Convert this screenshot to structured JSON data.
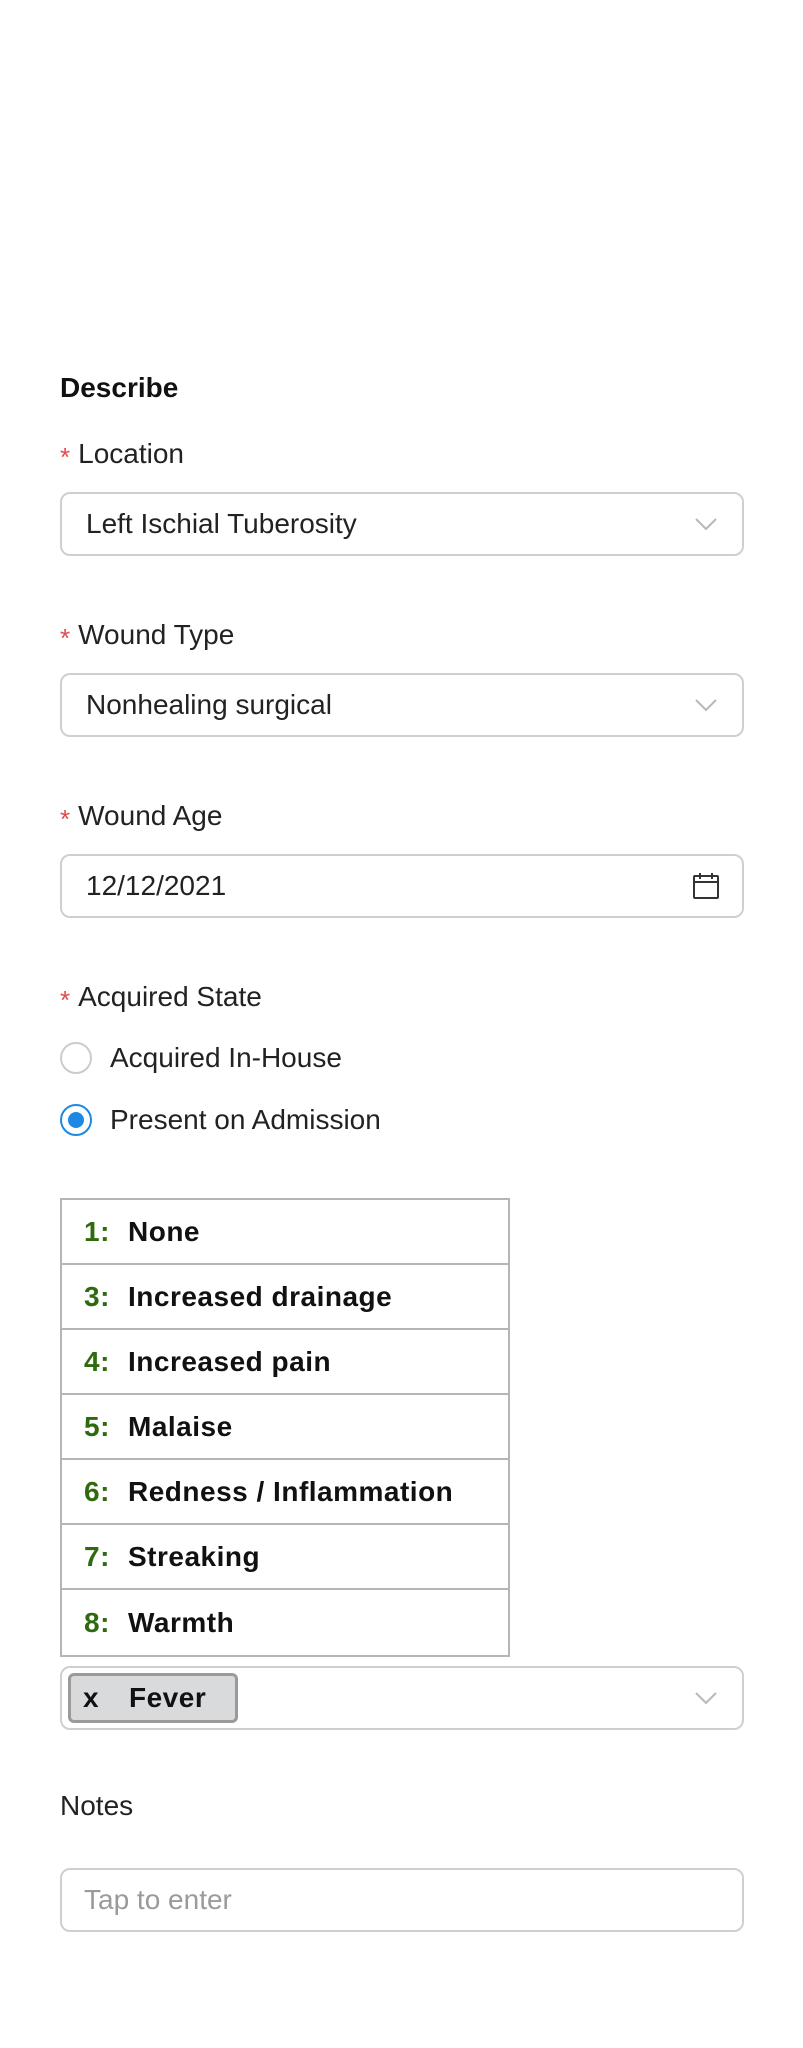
{
  "section": {
    "title": "Describe"
  },
  "location": {
    "label": "Location",
    "required_mark": "*",
    "value": "Left Ischial Tuberosity",
    "icon": "chevron-down-icon"
  },
  "wound_type": {
    "label": "Wound Type",
    "required_mark": "*",
    "value": "Nonhealing surgical",
    "icon": "chevron-down-icon"
  },
  "wound_age": {
    "label": "Wound Age",
    "required_mark": "*",
    "value": "12/12/2021",
    "icon": "calendar-icon"
  },
  "acquired_state": {
    "label": "Acquired State",
    "required_mark": "*",
    "options": [
      {
        "label": "Acquired In-House",
        "selected": false
      },
      {
        "label": "Present on Admission",
        "selected": true
      }
    ]
  },
  "signs_dropdown": {
    "options": [
      {
        "key": "1:",
        "label": "None"
      },
      {
        "key": "3:",
        "label": "Increased drainage"
      },
      {
        "key": "4:",
        "label": "Increased pain"
      },
      {
        "key": "5:",
        "label": "Malaise"
      },
      {
        "key": "6:",
        "label": "Redness / Inflammation"
      },
      {
        "key": "7:",
        "label": "Streaking"
      },
      {
        "key": "8:",
        "label": "Warmth"
      }
    ],
    "selected_tags": [
      {
        "remove": "x",
        "label": "Fever"
      }
    ],
    "icon": "chevron-down-icon"
  },
  "notes": {
    "label": "Notes",
    "placeholder": "Tap to enter"
  },
  "colors": {
    "required": "#e5484d",
    "radio_selected": "#1e88e5",
    "option_key": "#2e6b0f",
    "border": "#cfcfcf"
  }
}
